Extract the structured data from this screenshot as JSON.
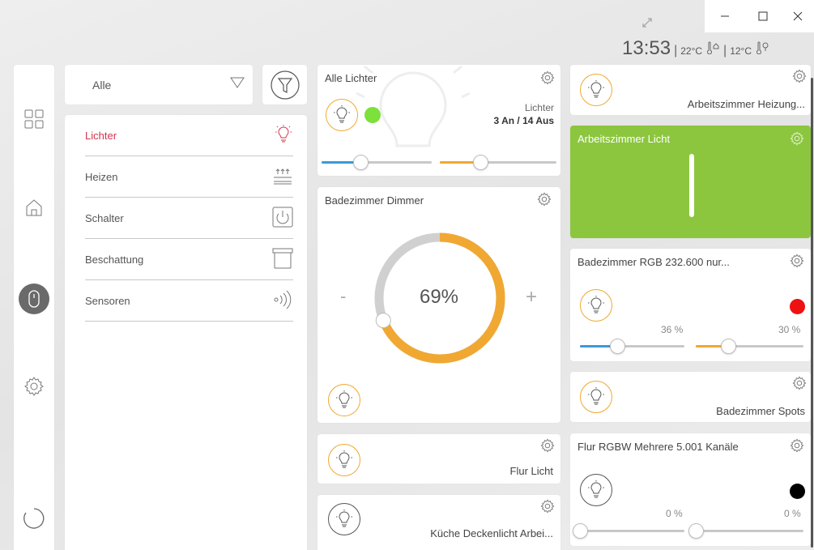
{
  "window": {
    "time": "13:53",
    "temp_inside": "22°C",
    "temp_outside": "12°C",
    "sep": "|"
  },
  "filter": {
    "selected": "Alle"
  },
  "categories": [
    {
      "label": "Lichter",
      "icon": "bulb-icon",
      "active": true
    },
    {
      "label": "Heizen",
      "icon": "heating-icon"
    },
    {
      "label": "Schalter",
      "icon": "power-switch-icon"
    },
    {
      "label": "Beschattung",
      "icon": "blind-icon"
    },
    {
      "label": "Sensoren",
      "icon": "sensor-icon"
    }
  ],
  "tiles": {
    "alle_lichter": {
      "title": "Alle Lichter",
      "sub_label": "Lichter",
      "status": "3 An / 14 Aus",
      "slider1": 0.35,
      "slider2": 0.35
    },
    "dimmer": {
      "title": "Badezimmer Dimmer",
      "value": "69%",
      "minus": "-",
      "plus": "+",
      "level": 0.69
    },
    "flur_licht": {
      "title": "Flur Licht"
    },
    "kueche": {
      "title": "Küche Deckenlicht Arbei..."
    },
    "heizung": {
      "title": "Arbeitszimmer Heizung..."
    },
    "az_licht": {
      "title": "Arbeitszimmer Licht"
    },
    "rgb": {
      "title": "Badezimmer RGB 232.600 nur...",
      "pct1": "36 %",
      "pct2": "30 %",
      "level1": 0.36,
      "level2": 0.3
    },
    "spots": {
      "title": "Badezimmer Spots"
    },
    "rgbw": {
      "title": "Flur RGBW Mehrere 5.001 Kanäle",
      "pct1": "0 %",
      "pct2": "0 %",
      "level1": 0,
      "level2": 0
    }
  },
  "colors": {
    "accent_red": "#d2334d",
    "orange": "#f0a832",
    "blue": "#3a9ad9",
    "green": "#8cc63f",
    "status_green": "#7ee03a",
    "rgb_red": "#ee1111",
    "rgbw_black": "#000000"
  }
}
